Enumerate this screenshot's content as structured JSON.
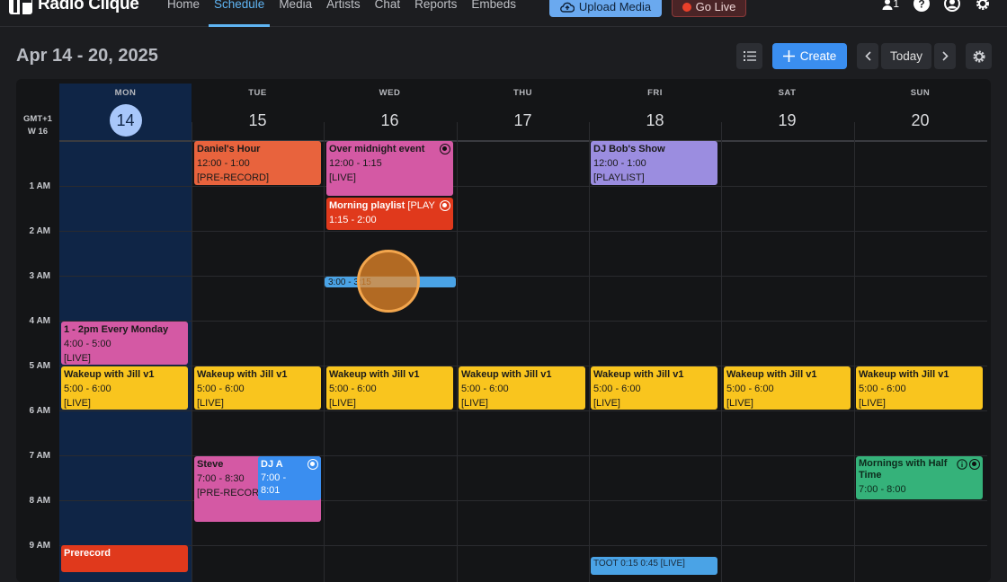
{
  "app": {
    "name": "Radio Clique"
  },
  "nav": {
    "items": [
      "Home",
      "Schedule",
      "Media",
      "Artists",
      "Chat",
      "Reports",
      "Embeds"
    ],
    "active": "Schedule"
  },
  "actions": {
    "upload": "Upload Media",
    "go_live": "Go Live"
  },
  "top_icons": {
    "user_count": "1"
  },
  "header": {
    "week_range": "Apr 14 - 20, 2025",
    "create": "Create",
    "today": "Today"
  },
  "calendar": {
    "timezone": "GMT+1",
    "week": "W 16",
    "days": [
      {
        "dow": "MON",
        "num": "14",
        "today": true
      },
      {
        "dow": "TUE",
        "num": "15"
      },
      {
        "dow": "WED",
        "num": "16"
      },
      {
        "dow": "THU",
        "num": "17"
      },
      {
        "dow": "FRI",
        "num": "18"
      },
      {
        "dow": "SAT",
        "num": "19"
      },
      {
        "dow": "SUN",
        "num": "20"
      }
    ],
    "hours": [
      "1 AM",
      "2 AM",
      "3 AM",
      "4 AM",
      "5 AM",
      "6 AM",
      "7 AM",
      "8 AM",
      "9 AM"
    ],
    "events": {
      "daniels_hour": {
        "title": "Daniel's Hour",
        "time": "12:00 - 1:00",
        "tag": "[PRE-RECORD]"
      },
      "over_midnight": {
        "title": "Over midnight event",
        "time": "12:00 - 1:15",
        "tag": "[LIVE]"
      },
      "morning_playlist": {
        "title": "Morning playlist",
        "tag": "[PLAY",
        "time": "1:15 - 2:00"
      },
      "wed_3am": {
        "time": "3:00 - 3:15"
      },
      "dj_bob": {
        "title": "DJ Bob's Show",
        "time": "12:00 - 1:00",
        "tag": "[PLAYLIST]"
      },
      "mon_every": {
        "title": "1 - 2pm Every Monday",
        "time": "4:00 - 5:00",
        "tag": "[LIVE]"
      },
      "wakeup": {
        "title": "Wakeup with Jill v1",
        "time": "5:00 - 6:00",
        "tag": "[LIVE]"
      },
      "steve": {
        "title": "Steve",
        "time": "7:00 - 8:30",
        "tag": "[PRE-RECORD"
      },
      "dj_a": {
        "title": "DJ A",
        "time1": "7:00 -",
        "time2": "8:01"
      },
      "mornings_half": {
        "title": "Mornings with Half Time",
        "time": "7:00 - 8:00"
      },
      "prerecord": {
        "title": "Prerecord"
      },
      "fri_bottom": {
        "text": "TOOT 0:15 0:45 [LIVE]"
      }
    }
  }
}
